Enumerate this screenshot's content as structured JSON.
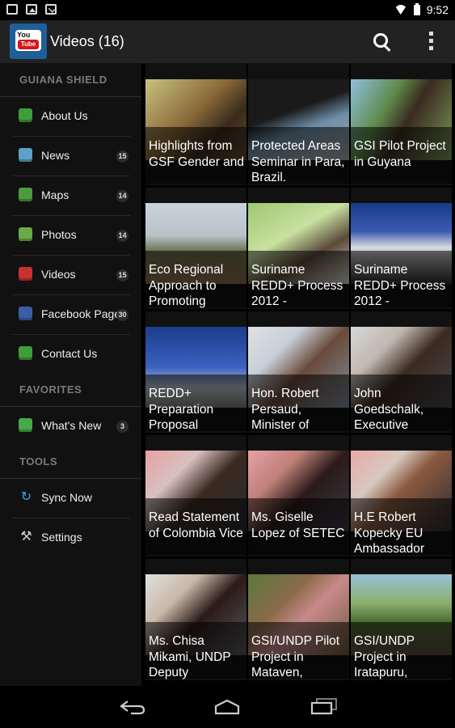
{
  "status_bar": {
    "time": "9:52"
  },
  "action_bar": {
    "title": "Videos (16)",
    "app_icon_text_top": "You",
    "app_icon_text_bottom": "Tube"
  },
  "drawer": {
    "section_main": "GUIANA SHIELD",
    "main_items": [
      {
        "label": "About Us",
        "badge": "",
        "icon": "about-icon",
        "color": "#3f9e3a"
      },
      {
        "label": "News",
        "badge": "15",
        "icon": "news-icon",
        "color": "#5fa0c8"
      },
      {
        "label": "Maps",
        "badge": "14",
        "icon": "maps-icon",
        "color": "#4e9a3e"
      },
      {
        "label": "Photos",
        "badge": "14",
        "icon": "photos-icon",
        "color": "#6aaa48"
      },
      {
        "label": "Videos",
        "badge": "15",
        "icon": "videos-icon",
        "color": "#c93030"
      },
      {
        "label": "Facebook Page",
        "badge": "30",
        "icon": "facebook-icon",
        "color": "#3b5da8"
      },
      {
        "label": "Contact Us",
        "badge": "",
        "icon": "contact-icon",
        "color": "#3f9e3a"
      }
    ],
    "section_favorites": "FAVORITES",
    "favorites_items": [
      {
        "label": "What's New",
        "badge": "3",
        "icon": "whats-new-icon",
        "color": "#48a84a"
      }
    ],
    "section_tools": "TOOLS",
    "tools_items": [
      {
        "label": "Sync Now",
        "icon": "sync-icon"
      },
      {
        "label": "Settings",
        "icon": "settings-icon"
      }
    ]
  },
  "videos": [
    {
      "title": "Highlights from GSF Gender and"
    },
    {
      "title": "Protected Areas Seminar in Para, Brazil."
    },
    {
      "title": "GSI Pilot Project in Guyana"
    },
    {
      "title": "Eco Regional Approach to Promoting"
    },
    {
      "title": "Suriname REDD+ Process 2012 -"
    },
    {
      "title": "Suriname REDD+ Process 2012 -"
    },
    {
      "title": "REDD+ Preparation Proposal"
    },
    {
      "title": "Hon. Robert Persaud, Minister of"
    },
    {
      "title": "John Goedschalk, Executive"
    },
    {
      "title": "Read Statement of Colombia Vice"
    },
    {
      "title": "Ms. Giselle Lopez of SETEC"
    },
    {
      "title": "H.E Robert Kopecky EU Ambassador"
    },
    {
      "title": "Ms. Chisa Mikami, UNDP Deputy"
    },
    {
      "title": "GSI/UNDP Pilot Project in Mataven,"
    },
    {
      "title": "GSI/UNDP Project in Iratapuru,"
    }
  ]
}
